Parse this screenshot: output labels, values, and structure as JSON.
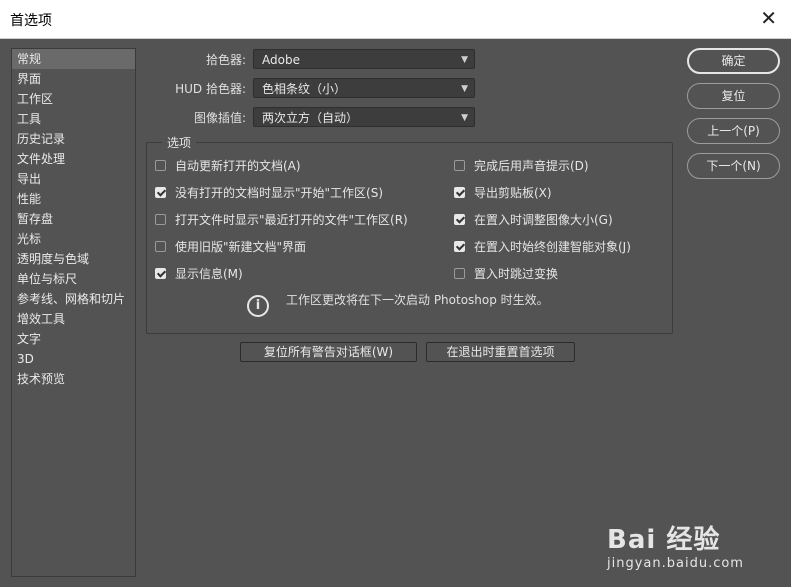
{
  "window": {
    "title": "首选项",
    "close_glyph": "✕"
  },
  "sidebar": {
    "items": [
      {
        "label": "常规",
        "active": true
      },
      {
        "label": "界面"
      },
      {
        "label": "工作区"
      },
      {
        "label": "工具"
      },
      {
        "label": "历史记录"
      },
      {
        "label": "文件处理"
      },
      {
        "label": "导出"
      },
      {
        "label": "性能"
      },
      {
        "label": "暂存盘"
      },
      {
        "label": "光标"
      },
      {
        "label": "透明度与色域"
      },
      {
        "label": "单位与标尺"
      },
      {
        "label": "参考线、网格和切片"
      },
      {
        "label": "增效工具"
      },
      {
        "label": "文字"
      },
      {
        "label": "3D"
      },
      {
        "label": "技术预览"
      }
    ]
  },
  "fields": {
    "color_picker": {
      "label": "拾色器:",
      "value": "Adobe"
    },
    "hud_color_picker": {
      "label": "HUD 拾色器:",
      "value": "色相条纹（小）"
    },
    "image_interpolation": {
      "label": "图像插值:",
      "value": "两次立方（自动）"
    }
  },
  "options": {
    "legend": "选项",
    "left": [
      {
        "label": "自动更新打开的文档(A)",
        "checked": false
      },
      {
        "label": "没有打开的文档时显示\"开始\"工作区(S)",
        "checked": true
      },
      {
        "label": "打开文件时显示\"最近打开的文件\"工作区(R)",
        "checked": false
      },
      {
        "label": "使用旧版\"新建文档\"界面",
        "checked": false
      },
      {
        "label": "显示信息(M)",
        "checked": true
      }
    ],
    "right": [
      {
        "label": "完成后用声音提示(D)",
        "checked": false
      },
      {
        "label": "导出剪贴板(X)",
        "checked": true
      },
      {
        "label": "在置入时调整图像大小(G)",
        "checked": true
      },
      {
        "label": "在置入时始终创建智能对象(J)",
        "checked": true
      },
      {
        "label": "置入时跳过变换",
        "checked": false
      }
    ],
    "info_glyph": "i",
    "info_text": "工作区更改将在下一次启动 Photoshop 时生效。"
  },
  "buttons": {
    "reset_warnings": "复位所有警告对话框(W)",
    "reset_on_quit": "在退出时重置首选项",
    "ok": "确定",
    "reset": "复位",
    "prev": "上一个(P)",
    "next": "下一个(N)"
  },
  "watermark": {
    "main": "Bai 经验",
    "sub": "jingyan.baidu.com"
  },
  "colors": {
    "bg": "#535353",
    "sidebar_active": "#6a6a6a",
    "titlebar": "#ffffff"
  }
}
